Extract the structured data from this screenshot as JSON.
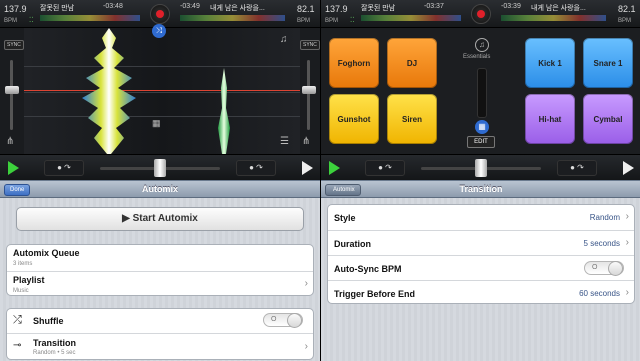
{
  "left_deck": {
    "deck_a": {
      "bpm": "137.9",
      "bpm_label": "BPM",
      "track": "잘못된 만남",
      "time": "-03:48"
    },
    "deck_b": {
      "bpm": "82.1",
      "bpm_label": "BPM",
      "track": "내게 남은 사랑을...",
      "time": "-03:49"
    },
    "sync_label": "SYNC",
    "note_icon": "music-note-icon",
    "mixer_icon": "mixer-icon"
  },
  "right_deck": {
    "deck_a": {
      "bpm": "137.9",
      "bpm_label": "BPM",
      "track": "잘못된 만남",
      "time": "-03:37"
    },
    "deck_b": {
      "bpm": "82.1",
      "bpm_label": "BPM",
      "track": "내게 남은 사랑을...",
      "time": "-03:39"
    },
    "pads_left": [
      "Foghorn",
      "DJ",
      "Gunshot",
      "Siren"
    ],
    "pads_right": [
      "Kick 1",
      "Snare 1",
      "Hi-hat",
      "Cymbal"
    ],
    "essentials_label": "Essentials",
    "edit_label": "EDIT"
  },
  "automix": {
    "done_label": "Done",
    "title": "Automix",
    "start_label": "Start Automix",
    "queue": {
      "title": "Automix Queue",
      "sub": "3 items"
    },
    "playlist": {
      "title": "Playlist",
      "sub": "Music"
    },
    "shuffle": {
      "title": "Shuffle",
      "state": "O"
    },
    "transition": {
      "title": "Transition",
      "sub": "Random • 5 sec"
    }
  },
  "transition": {
    "back_label": "Automix",
    "title": "Transition",
    "rows": [
      {
        "label": "Style",
        "value": "Random"
      },
      {
        "label": "Duration",
        "value": "5 seconds"
      },
      {
        "label": "Auto-Sync BPM",
        "value": "O"
      },
      {
        "label": "Trigger Before End",
        "value": "60 seconds"
      }
    ]
  },
  "colors": {
    "record": "#e0202a",
    "play": "#3cd13c",
    "accent": "#385487"
  }
}
